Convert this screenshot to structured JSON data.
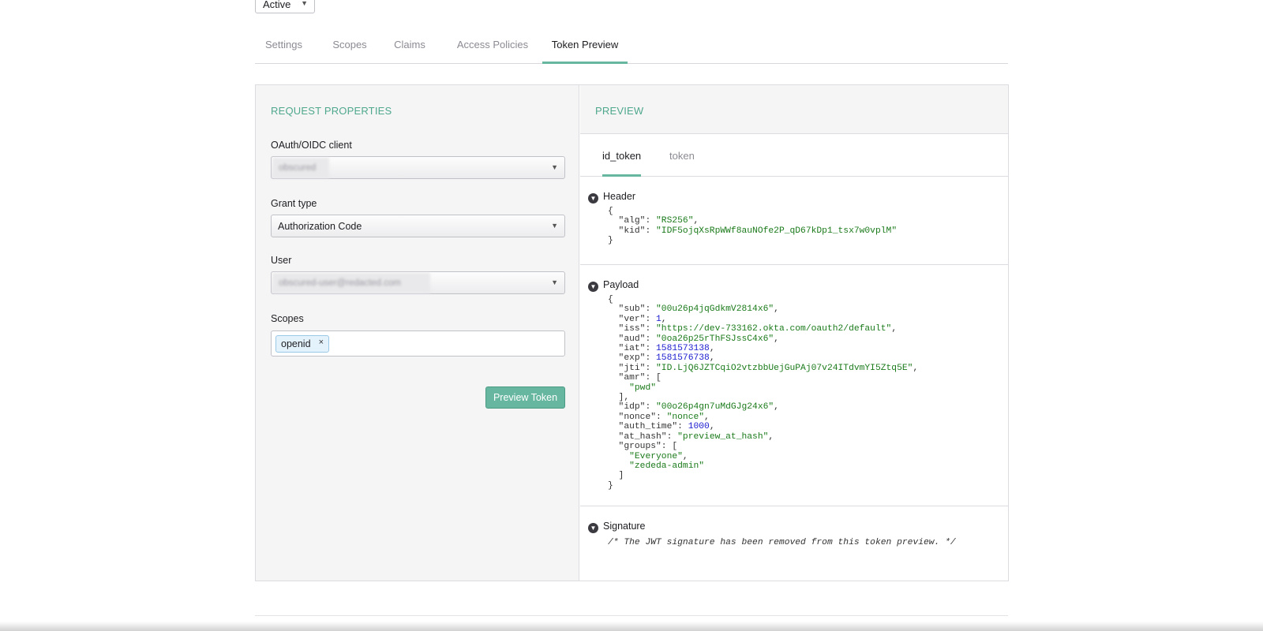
{
  "status": {
    "value": "Active"
  },
  "tabs": [
    {
      "label": "Settings"
    },
    {
      "label": "Scopes"
    },
    {
      "label": "Claims"
    },
    {
      "label": "Access Policies"
    },
    {
      "label": "Token Preview"
    }
  ],
  "request": {
    "title": "REQUEST PROPERTIES",
    "client_label": "OAuth/OIDC client",
    "client_value": "obscured",
    "grant_label": "Grant type",
    "grant_value": "Authorization Code",
    "user_label": "User",
    "user_value": "obscured-user@redacted.com",
    "scopes_label": "Scopes",
    "scope_chip": "openid",
    "scope_remove": "×",
    "button": "Preview Token"
  },
  "preview": {
    "title": "PREVIEW",
    "tabs": [
      {
        "label": "id_token"
      },
      {
        "label": "token"
      }
    ],
    "header_label": "Header",
    "payload_label": "Payload",
    "signature_label": "Signature",
    "header": {
      "alg": "RS256",
      "kid": "IDF5ojqXsRpWWf8auNOfe2P_qD67kDp1_tsx7w0vplM"
    },
    "payload": {
      "sub": "00u26p4jqGdkmV2814x6",
      "ver": "1",
      "iss": "https://dev-733162.okta.com/oauth2/default",
      "aud": "0oa26p25rThFSJssC4x6",
      "iat": "1581573138",
      "exp": "1581576738",
      "jti": "ID.LjQ6JZTCqiO2vtzbbUejGuPAj07v24ITdvmYI5Ztq5E",
      "amr": [
        "pwd"
      ],
      "idp": "00o26p4gn7uMdGJg24x6",
      "nonce": "nonce",
      "auth_time": "1000",
      "at_hash": "preview_at_hash",
      "groups": [
        "Everyone",
        "zededa-admin"
      ]
    },
    "signature_comment": "/* The JWT signature has been removed from this token preview. */"
  },
  "colors": {
    "accent": "#67b7a0",
    "string": "#1a7a1a",
    "number": "#1a1ad0"
  }
}
